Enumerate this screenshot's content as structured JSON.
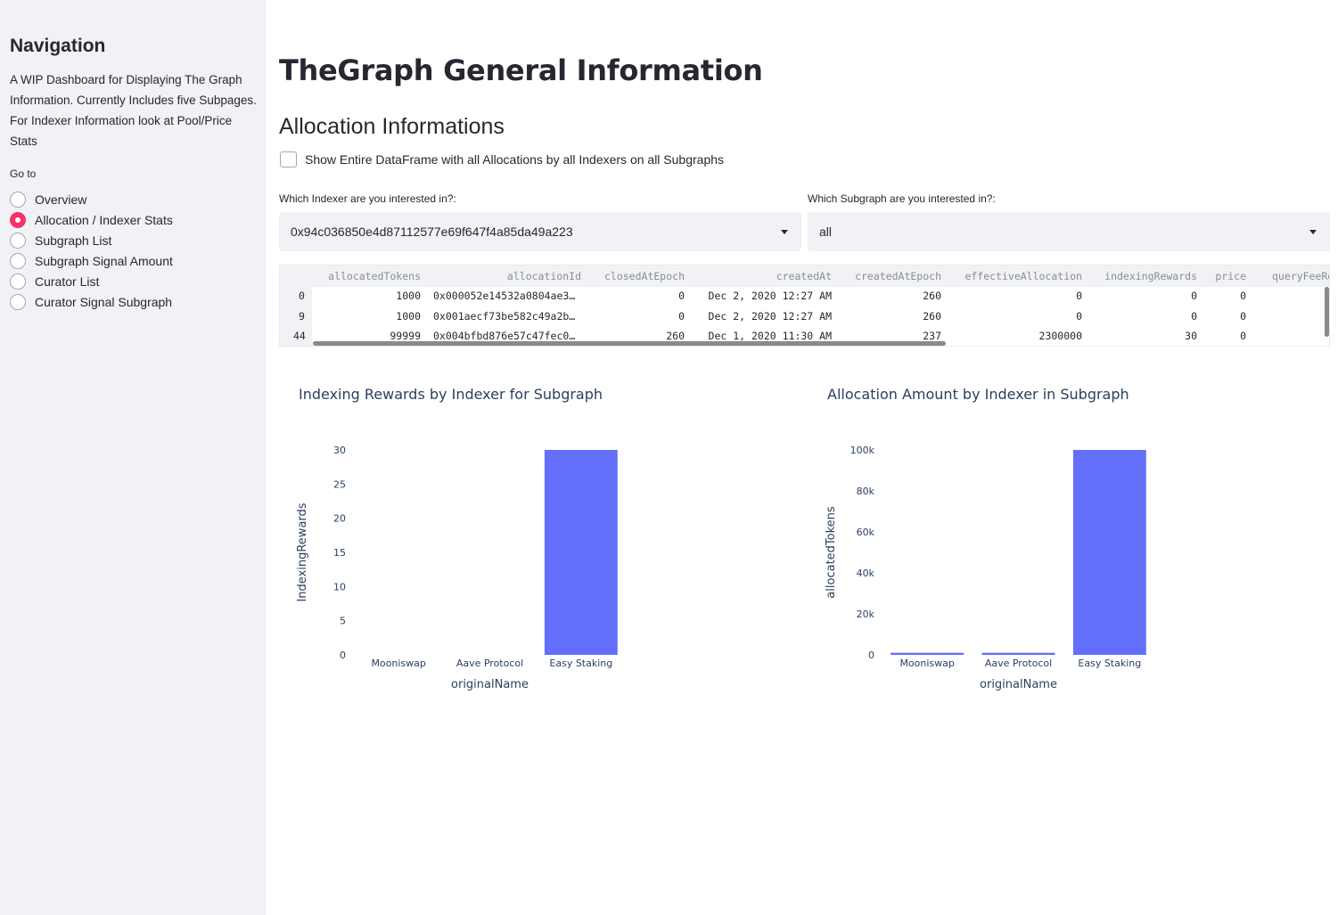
{
  "sidebar": {
    "title": "Navigation",
    "description": "A WIP Dashboard for Displaying The Graph Information. Currently Includes five Subpages. For Indexer Information look at Pool/Price Stats",
    "goto_label": "Go to",
    "items": [
      {
        "label": "Overview",
        "checked": false
      },
      {
        "label": "Allocation / Indexer Stats",
        "checked": true
      },
      {
        "label": "Subgraph List",
        "checked": false
      },
      {
        "label": "Subgraph Signal Amount",
        "checked": false
      },
      {
        "label": "Curator List",
        "checked": false
      },
      {
        "label": "Curator Signal Subgraph",
        "checked": false
      }
    ]
  },
  "main": {
    "title": "TheGraph General Information",
    "section_title": "Allocation Informations",
    "checkbox_label": "Show Entire DataFrame with all Allocations by all Indexers on all Subgraphs",
    "indexer_select": {
      "label": "Which Indexer are you interested in?:",
      "value": "0x94c036850e4d87112577e69f647f4a85da49a223"
    },
    "subgraph_select": {
      "label": "Which Subgraph are you interested in?:",
      "value": "all"
    }
  },
  "table": {
    "columns": [
      "allocatedTokens",
      "allocationId",
      "closedAtEpoch",
      "createdAt",
      "createdAtEpoch",
      "effectiveAllocation",
      "indexingRewards",
      "price",
      "queryFeeRe"
    ],
    "rows": [
      {
        "index": "0",
        "cells": [
          "1000",
          "0x000052e14532a0804ae3…",
          "0",
          "Dec 2, 2020 12:27 AM",
          "260",
          "0",
          "0",
          "0"
        ]
      },
      {
        "index": "9",
        "cells": [
          "1000",
          "0x001aecf73be582c49a2b…",
          "0",
          "Dec 2, 2020 12:27 AM",
          "260",
          "0",
          "0",
          "0"
        ]
      },
      {
        "index": "44",
        "cells": [
          "99999",
          "0x004bfbd876e57c47fec0…",
          "260",
          "Dec 1, 2020 11:30 AM",
          "237",
          "2300000",
          "30",
          "0"
        ]
      }
    ]
  },
  "colors": {
    "accent": "#f63366",
    "bar": "#636efa",
    "sidebar_bg": "#f0f2f6"
  },
  "chart_data": [
    {
      "type": "bar",
      "title": "Indexing Rewards by Indexer for Subgraph",
      "xlabel": "originalName",
      "ylabel": "IndexingRewards",
      "categories": [
        "Mooniswap",
        "Aave Protocol",
        "Easy Staking"
      ],
      "values": [
        0,
        0,
        30
      ],
      "ylim": [
        0,
        30
      ],
      "yticks": [
        0,
        5,
        10,
        15,
        20,
        25,
        30
      ],
      "ytick_labels": [
        "0",
        "5",
        "10",
        "15",
        "20",
        "25",
        "30"
      ]
    },
    {
      "type": "bar",
      "title": "Allocation Amount by Indexer in Subgraph",
      "xlabel": "originalName",
      "ylabel": "allocatedTokens",
      "categories": [
        "Mooniswap",
        "Aave Protocol",
        "Easy Staking"
      ],
      "values": [
        1000,
        1000,
        99999
      ],
      "ylim": [
        0,
        100000
      ],
      "yticks": [
        0,
        20000,
        40000,
        60000,
        80000,
        100000
      ],
      "ytick_labels": [
        "0",
        "20k",
        "40k",
        "60k",
        "80k",
        "100k"
      ]
    }
  ]
}
